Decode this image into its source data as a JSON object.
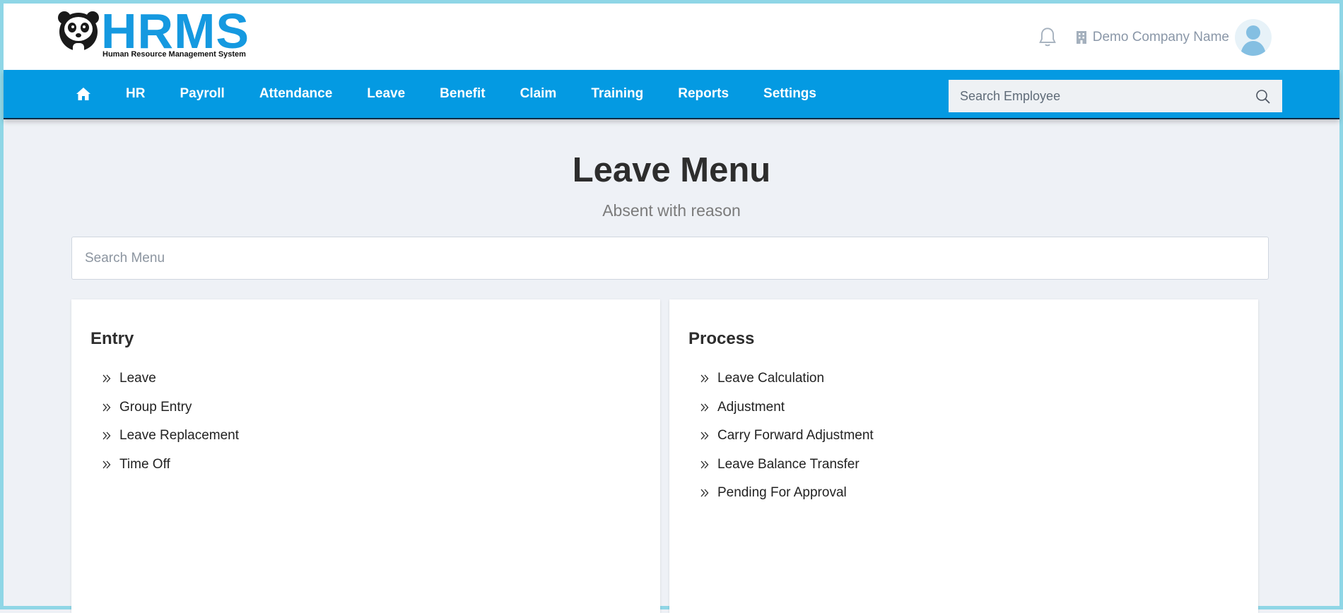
{
  "logo": {
    "word": "HRMS",
    "tagline": "Human Resource Management System"
  },
  "header": {
    "company_name": "Demo Company Name"
  },
  "nav": {
    "items": [
      "HR",
      "Payroll",
      "Attendance",
      "Leave",
      "Benefit",
      "Claim",
      "Training",
      "Reports",
      "Settings"
    ],
    "search_placeholder": "Search Employee"
  },
  "page": {
    "title": "Leave Menu",
    "subtitle": "Absent with reason",
    "search_placeholder": "Search Menu"
  },
  "sections": {
    "entry": {
      "title": "Entry",
      "items": [
        "Leave",
        "Group Entry",
        "Leave Replacement",
        "Time Off"
      ]
    },
    "process": {
      "title": "Process",
      "items": [
        "Leave Calculation",
        "Adjustment",
        "Carry Forward Adjustment",
        "Leave Balance Transfer",
        "Pending For Approval"
      ]
    }
  },
  "colors": {
    "brand": "#049ae2",
    "logo": "#1599e0",
    "page_bg": "#eef1f6"
  }
}
